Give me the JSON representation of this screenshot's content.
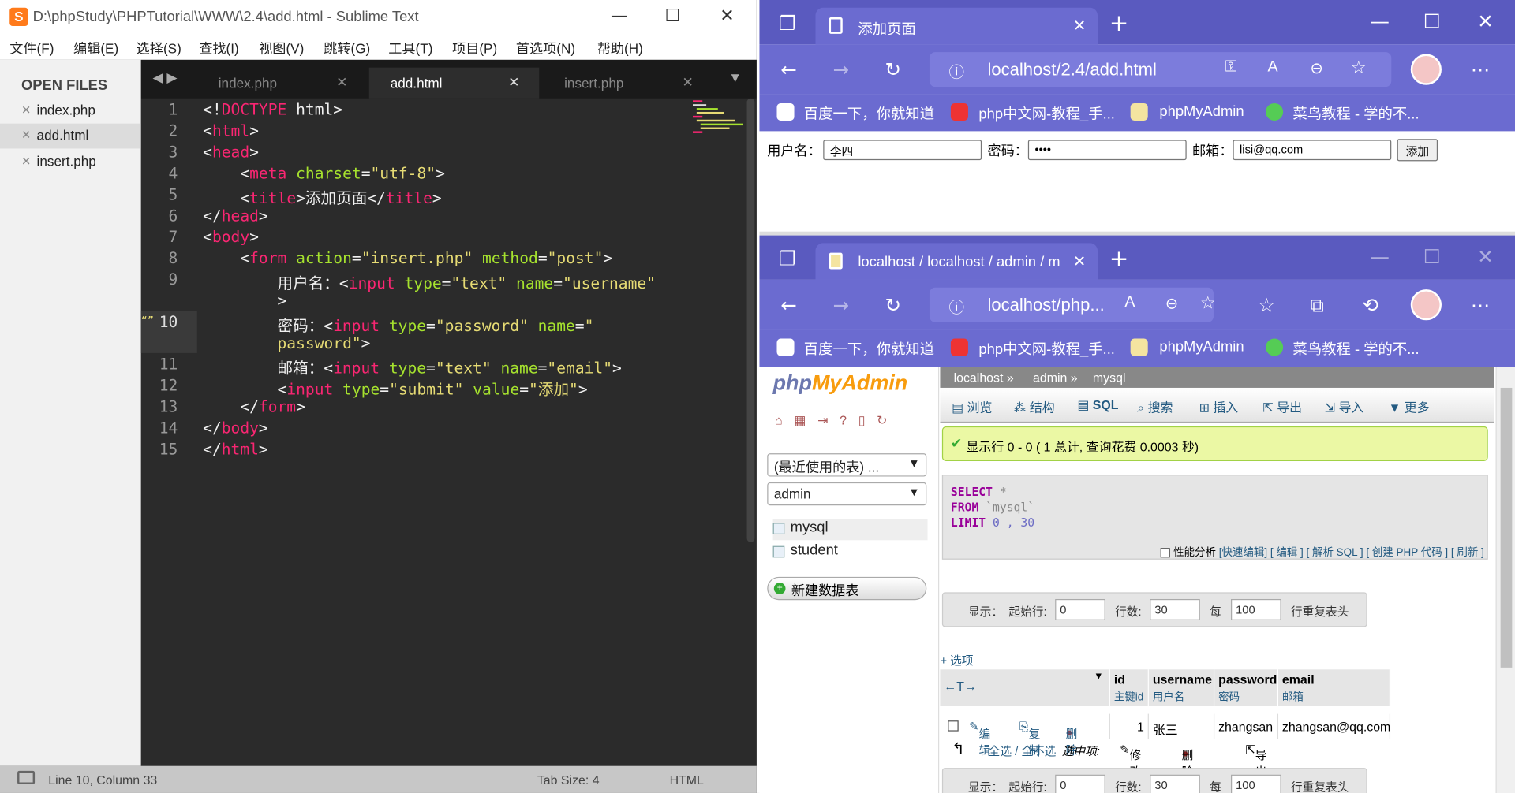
{
  "sublime": {
    "title": "D:\\phpStudy\\PHPTutorial\\WWW\\2.4\\add.html - Sublime Text",
    "menu": [
      "文件(F)",
      "编辑(E)",
      "选择(S)",
      "查找(I)",
      "视图(V)",
      "跳转(G)",
      "工具(T)",
      "项目(P)",
      "首选项(N)",
      "帮助(H)"
    ],
    "open_files_header": "OPEN FILES",
    "open_files": [
      "index.php",
      "add.html",
      "insert.php"
    ],
    "tabs": [
      "index.php",
      "add.html",
      "insert.php"
    ],
    "line_numbers": [
      "1",
      "2",
      "3",
      "4",
      "5",
      "6",
      "7",
      "8",
      "9",
      "",
      "10",
      "",
      "11",
      "12",
      "13",
      "14",
      "15"
    ],
    "status": {
      "position": "Line 10, Column 33",
      "tab_size": "Tab Size: 4",
      "syntax": "HTML"
    }
  },
  "browser_top": {
    "tab_title": "添加页面",
    "url": "localhost/2.4/add.html",
    "favorites": [
      "百度一下，你就知道",
      "php中文网-教程_手...",
      "phpMyAdmin",
      "菜鸟教程 - 学的不..."
    ],
    "form": {
      "username_label": "用户名：",
      "username_value": "李四",
      "password_label": "密码：",
      "password_value": "••••",
      "email_label": "邮箱：",
      "email_value": "lisi@qq.com",
      "submit_label": "添加"
    }
  },
  "browser_bottom": {
    "tab_title": "localhost / localhost / admin / m",
    "url": "localhost/php...",
    "favorites": [
      "百度一下，你就知道",
      "php中文网-教程_手...",
      "phpMyAdmin",
      "菜鸟教程 - 学的不..."
    ]
  },
  "pma": {
    "logo_a": "php",
    "logo_b": "MyAdmin",
    "recent_select": "(最近使用的表) ...",
    "db_select": "admin",
    "tables": [
      "mysql",
      "student"
    ],
    "new_table": "新建数据表",
    "breadcrumb": [
      "localhost »",
      "admin »",
      "mysql"
    ],
    "tabs": [
      "浏览",
      "结构",
      "SQL",
      "搜索",
      "插入",
      "导出",
      "导入",
      "更多"
    ],
    "success": "显示行 0 - 0 ( 1 总计, 查询花费 0.0003 秒)",
    "sql": {
      "select": "SELECT",
      "star": "*",
      "from": "FROM",
      "table": "`mysql`",
      "limit": "LIMIT",
      "limit_args": "0 , 30"
    },
    "profiling": "性能分析",
    "profile_links": [
      "[快速编辑]",
      "[ 编辑 ]",
      "[ 解析 SQL ]",
      "[ 创建 PHP 代码 ]",
      "[ 刷新 ]"
    ],
    "nav": {
      "show": "显示：",
      "start": "起始行:",
      "start_val": "0",
      "rows": "行数:",
      "rows_val": "30",
      "per": "每",
      "per_val": "100",
      "repeat": "行重复表头"
    },
    "options_link": "+ 选项",
    "arrows": "←T→",
    "columns": [
      {
        "name": "id",
        "comment": "主键id"
      },
      {
        "name": "username",
        "comment": "用户名"
      },
      {
        "name": "password",
        "comment": "密码"
      },
      {
        "name": "email",
        "comment": "邮箱"
      }
    ],
    "row": {
      "edit": "编辑",
      "copy": "复制",
      "delete": "删除",
      "id": "1",
      "username": "张三",
      "password": "zhangsan",
      "email": "zhangsan@qq.com"
    },
    "bulk": {
      "select_all": "全选 / 全不选",
      "selected": "选中项:",
      "edit": "修改",
      "delete": "删除",
      "export": "导出"
    },
    "nav2": {
      "show": "显示：",
      "start": "起始行:",
      "start_val": "0",
      "rows": "行数:",
      "rows_val": "30",
      "per": "每",
      "per_val": "100",
      "repeat": "行重复表头"
    }
  }
}
